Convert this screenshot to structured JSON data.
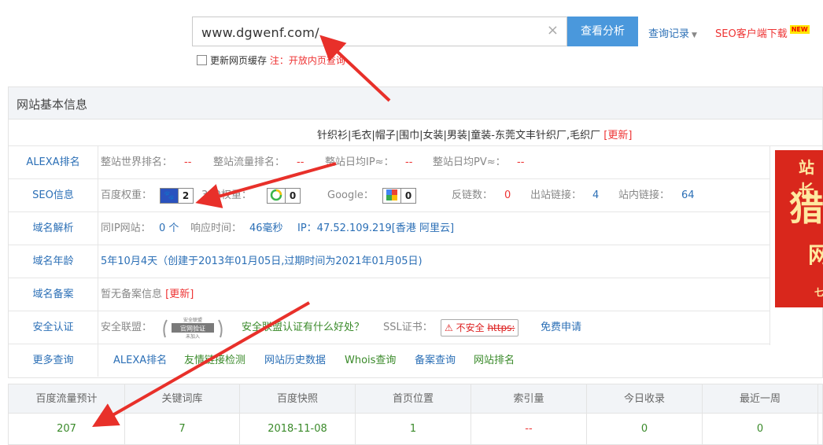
{
  "search": {
    "value": "www.dgwenf.com/",
    "clear_icon": "×",
    "analyze_label": "查看分析"
  },
  "header": {
    "history_label": "查询记录",
    "seo_client_label": "SEO客户端下载",
    "new_badge": "NEW"
  },
  "cache": {
    "label": "更新网页缓存",
    "note": "注：开放内页查询"
  },
  "panel": {
    "title": "网站基本信息",
    "site_title": "针织衫|毛衣|帽子|围巾|女装|男装|童装-东莞文丰针织厂,毛织厂",
    "update_label": "[更新]"
  },
  "rows": {
    "alexa": {
      "label": "ALEXA排名",
      "world_label": "整站世界排名：",
      "world_val": "--",
      "flow_label": "整站流量排名：",
      "flow_val": "--",
      "ip_label": "整站日均IP≈：",
      "ip_val": "--",
      "pv_label": "整站日均PV≈：",
      "pv_val": "--"
    },
    "seo": {
      "label": "SEO信息",
      "baidu_label": "百度权重：",
      "baidu_val": "2",
      "so360_label": "360权重：",
      "so360_val": "0",
      "google_label": "Google：",
      "google_val": "0",
      "backlinks_label": "反链数：",
      "backlinks_val": "0",
      "outlinks_label": "出站链接：",
      "outlinks_val": "4",
      "inlinks_label": "站内链接：",
      "inlinks_val": "64"
    },
    "dns": {
      "label": "域名解析",
      "sameip_label": "同IP网站：",
      "sameip_val": "0 个",
      "resp_label": "响应时间：",
      "resp_val": "46毫秒",
      "ip_text": "IP：47.52.109.219[香港 阿里云]"
    },
    "age": {
      "label": "域名年龄",
      "value": "5年10月4天（创建于2013年01月05日,过期时间为2021年01月05日)"
    },
    "icp": {
      "label": "域名备案",
      "value": "暂无备案信息",
      "update_label": "[更新]"
    },
    "security": {
      "label": "安全认证",
      "alliance_label": "安全联盟：",
      "alliance_badge_top": "安全联盟",
      "alliance_badge_main": "官网验证",
      "alliance_badge_sub": "未加入",
      "alliance_link": "安全联盟认证有什么好处？",
      "ssl_label": "SSL证书：",
      "ssl_badge_text": "不安全",
      "ssl_badge_https": "https:",
      "ssl_apply": "免费申请"
    },
    "more": {
      "label": "更多查询",
      "links": [
        "ALEXA排名",
        "友情链接检测",
        "网站历史数据",
        "Whois查询",
        "备案查询",
        "网站排名"
      ]
    }
  },
  "side_ad": {
    "text1": "站长",
    "text2": "猎",
    "text3": "网",
    "text4": "七"
  },
  "stats": {
    "headers": [
      "百度流量预计",
      "关键词库",
      "百度快照",
      "首页位置",
      "索引量",
      "今日收录",
      "最近一周"
    ],
    "values": [
      "207",
      "7",
      "2018-11-08",
      "1",
      "--",
      "0",
      "0"
    ]
  },
  "colors": {
    "accent_blue": "#4a98dc",
    "link_blue": "#2b6fb6",
    "red": "#e33",
    "green": "#3a8a2a",
    "arrow_red": "#e8302a"
  }
}
